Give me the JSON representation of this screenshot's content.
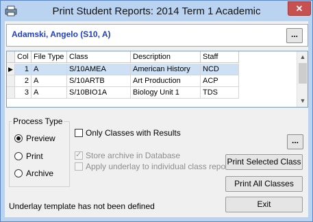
{
  "window": {
    "title": "Print Student Reports:  2014 Term 1 Academic",
    "close_glyph": "✕"
  },
  "student": {
    "name": "Adamski, Angelo (S10, A)",
    "more_label": "..."
  },
  "grid": {
    "columns": [
      "Col",
      "File Type",
      "Class",
      "Description",
      "Staff"
    ],
    "rows": [
      {
        "col": "1",
        "file_type": "A",
        "class": "S/10AMEA",
        "description": "American History",
        "staff": "NCD"
      },
      {
        "col": "2",
        "file_type": "A",
        "class": "S/10ARTB",
        "description": "Art Production",
        "staff": "ACP"
      },
      {
        "col": "3",
        "file_type": "A",
        "class": "S/10BIO1A",
        "description": "Biology Unit 1",
        "staff": "TDS"
      }
    ],
    "current_row_marker": "▶"
  },
  "process_type": {
    "label": "Process Type",
    "options": [
      "Preview",
      "Print",
      "Archive"
    ],
    "selected": "Preview"
  },
  "options": {
    "only_classes_with_results": "Only Classes with Results",
    "store_archive": "Store archive in Database",
    "apply_underlay": "Apply underlay to individual class reports",
    "options_more_label": "..."
  },
  "buttons": {
    "print_selected": "Print Selected Class",
    "print_all": "Print All Classes",
    "exit": "Exit"
  },
  "status": "Underlay template has not been defined",
  "colors": {
    "title_bar": "#bad3f0",
    "student_name": "#1f3fbf",
    "selected_row": "#cde0f4",
    "close_button": "#c75050"
  }
}
